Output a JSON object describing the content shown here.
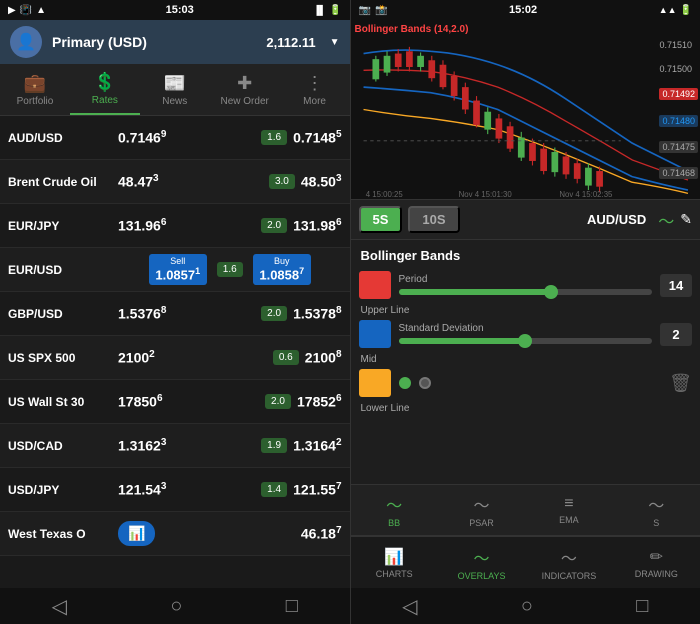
{
  "left": {
    "statusBar": {
      "time": "15:03",
      "icons": [
        "📶",
        "🔋"
      ]
    },
    "account": {
      "name": "Primary (USD)",
      "balance": "2,112.11",
      "currency": "▼"
    },
    "nav": [
      {
        "id": "portfolio",
        "label": "Portfolio",
        "icon": "💼",
        "active": false
      },
      {
        "id": "rates",
        "label": "Rates",
        "icon": "💲",
        "active": true
      },
      {
        "id": "news",
        "label": "News",
        "icon": "📰",
        "active": false
      },
      {
        "id": "new-order",
        "label": "New Order",
        "icon": "✚",
        "active": false
      },
      {
        "id": "more",
        "label": "More",
        "icon": "⋮",
        "active": false
      }
    ],
    "currencies": [
      {
        "name": "AUD/USD",
        "bid": "0.7146",
        "bidSup": "9",
        "spread": "1.6",
        "ask": "0.7148",
        "askSup": "5",
        "highlight": false
      },
      {
        "name": "Brent Crude Oil",
        "bid": "48.47",
        "bidSup": "3",
        "spread": "3.0",
        "ask": "48.50",
        "askSup": "3",
        "highlight": false
      },
      {
        "name": "EUR/JPY",
        "bid": "131.96",
        "bidSup": "6",
        "spread": "2.0",
        "ask": "131.98",
        "askSup": "6",
        "highlight": false
      },
      {
        "name": "EUR/USD",
        "sellLabel": "Sell",
        "sellPrice": "1.0857",
        "sellSup": "1",
        "spread": "1.6",
        "buyLabel": "Buy",
        "buyPrice": "1.0858",
        "buySup": "7",
        "highlight": true
      },
      {
        "name": "GBP/USD",
        "bid": "1.5376",
        "bidSup": "8",
        "spread": "2.0",
        "ask": "1.5378",
        "askSup": "8",
        "highlight": false
      },
      {
        "name": "US SPX 500",
        "bid": "2100",
        "bidSup": "2",
        "spread": "0.6",
        "ask": "2100",
        "askSup": "8",
        "highlight": false
      },
      {
        "name": "US Wall St 30",
        "bid": "17850",
        "bidSup": "6",
        "spread": "2.0",
        "ask": "17852",
        "askSup": "6",
        "highlight": false
      },
      {
        "name": "USD/CAD",
        "bid": "1.3162",
        "bidSup": "3",
        "spread": "1.9",
        "ask": "1.3164",
        "askSup": "2",
        "highlight": false
      },
      {
        "name": "USD/JPY",
        "bid": "121.54",
        "bidSup": "3",
        "spread": "1.4",
        "ask": "121.55",
        "askSup": "7",
        "highlight": false
      },
      {
        "name": "West Texas O",
        "barChart": true,
        "ask": "46.18",
        "askSup": "7",
        "highlight": false
      }
    ],
    "bottomNav": [
      "◁",
      "○",
      "□"
    ]
  },
  "right": {
    "statusBar": {
      "time": "15:02"
    },
    "chart": {
      "label": "Bollinger Bands (14,2.0)",
      "timeTicks": [
        "4 15:00:25",
        "Nov 4 15:01:30",
        "Nov 4 15:02:35"
      ],
      "priceLevels": [
        {
          "value": "0.71510",
          "type": "normal"
        },
        {
          "value": "0.71500",
          "type": "normal"
        },
        {
          "value": "0.71492",
          "type": "red"
        },
        {
          "value": "0.71480",
          "type": "blue"
        },
        {
          "value": "0.71475",
          "type": "gray"
        },
        {
          "value": "0.71468",
          "type": "gray"
        }
      ]
    },
    "timeframes": [
      {
        "label": "5S",
        "active": true
      },
      {
        "label": "10S",
        "active": false
      }
    ],
    "pair": "AUD/USD",
    "bollingerBands": {
      "title": "Bollinger Bands",
      "period": {
        "label": "Period",
        "value": "14",
        "fillPercent": 60
      },
      "stdDev": {
        "label": "Standard Deviation",
        "value": "2",
        "fillPercent": 50
      },
      "lines": [
        {
          "label": "Upper Line",
          "color": "red"
        },
        {
          "label": "Mid",
          "color": "blue"
        },
        {
          "label": "Lower Line",
          "color": "yellow",
          "toggleActive": true,
          "toggleInactive": true
        }
      ]
    },
    "indicatorTabs": [
      {
        "id": "bb",
        "label": "BB",
        "icon": "〜",
        "active": true
      },
      {
        "id": "psar",
        "label": "PSAR",
        "icon": "〜",
        "active": false
      },
      {
        "id": "ema",
        "label": "EMA",
        "icon": "≡",
        "active": false
      },
      {
        "id": "s",
        "label": "S",
        "icon": "〜",
        "active": false
      }
    ],
    "bottomTabs": [
      {
        "id": "charts",
        "label": "CHARTS",
        "icon": "📊",
        "active": false
      },
      {
        "id": "overlays",
        "label": "OVERLAYS",
        "icon": "〜",
        "active": true
      },
      {
        "id": "indicators",
        "label": "INDICATORS",
        "icon": "〜",
        "active": false
      },
      {
        "id": "drawing",
        "label": "DRAWING",
        "icon": "✏",
        "active": false
      }
    ],
    "bottomNav": [
      "◁",
      "○",
      "□"
    ]
  }
}
